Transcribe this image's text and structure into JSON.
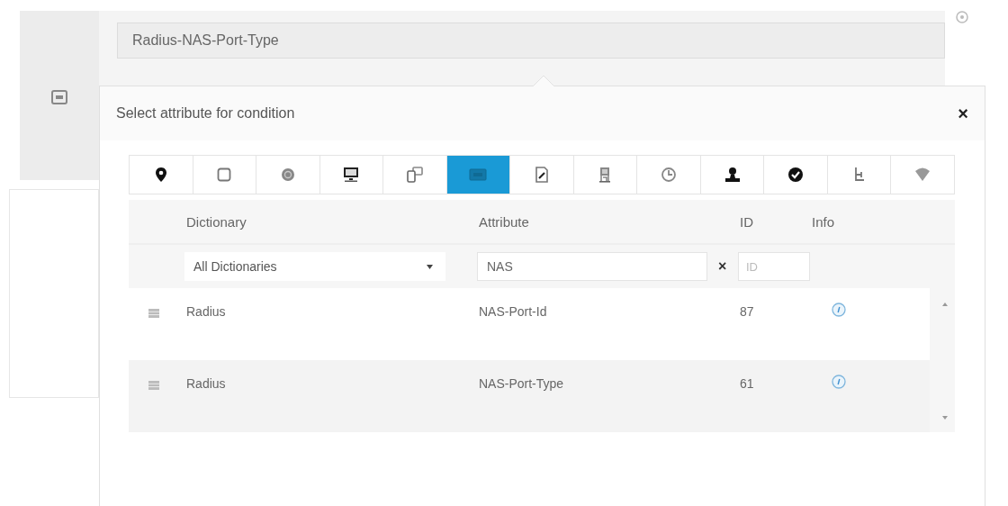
{
  "condition_field": {
    "value": "Radius-NAS-Port-Type"
  },
  "popover": {
    "title": "Select attribute for condition",
    "close": "×",
    "tabs": [
      {
        "selected": false
      },
      {
        "selected": false
      },
      {
        "selected": false
      },
      {
        "selected": false
      },
      {
        "selected": false
      },
      {
        "selected": true
      },
      {
        "selected": false
      },
      {
        "selected": false
      },
      {
        "selected": false
      },
      {
        "selected": false
      },
      {
        "selected": false
      },
      {
        "selected": false
      },
      {
        "selected": false
      }
    ],
    "table": {
      "columns": [
        "Dictionary",
        "Attribute",
        "ID",
        "Info"
      ],
      "filters": {
        "dictionary": "All Dictionaries",
        "attribute": "NAS",
        "clear": "×",
        "id_placeholder": "ID"
      },
      "rows": [
        {
          "dictionary": "Radius",
          "attribute": "NAS-Port-Id",
          "id": "87"
        },
        {
          "dictionary": "Radius",
          "attribute": "NAS-Port-Type",
          "id": "61"
        }
      ]
    }
  }
}
